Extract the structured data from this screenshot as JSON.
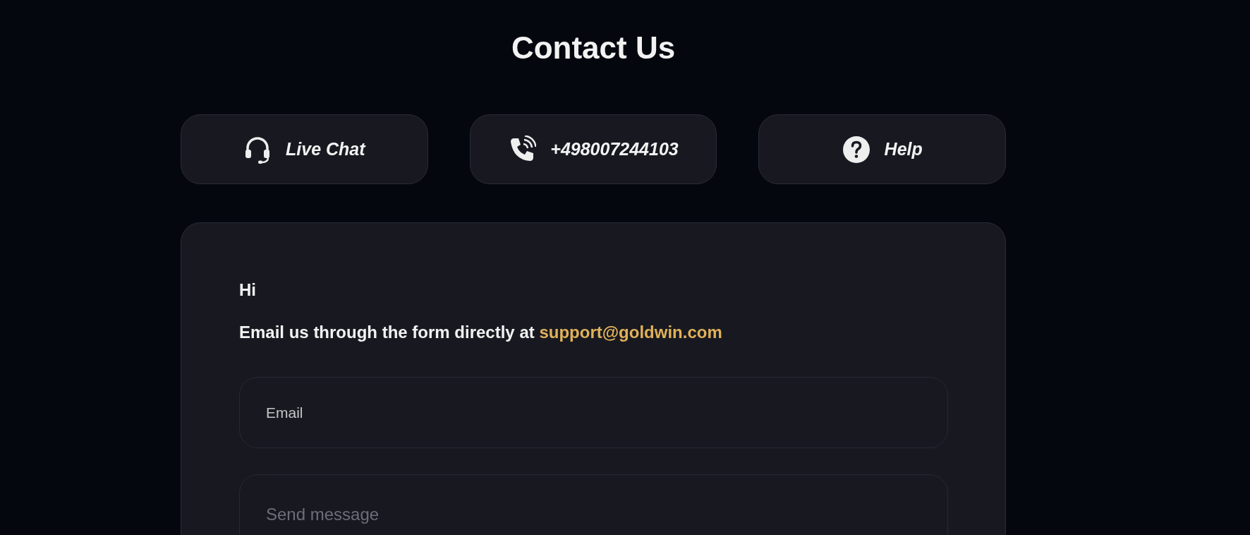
{
  "title": "Contact Us",
  "channels": [
    {
      "kind": "chat",
      "label": "Live Chat"
    },
    {
      "kind": "phone",
      "label": "+498007244103"
    },
    {
      "kind": "help",
      "label": "Help"
    }
  ],
  "form": {
    "greeting": "Hi",
    "intro": "Email us through the form directly at ",
    "email_link": "support@goldwin.com",
    "email_field": {
      "label": "Email"
    },
    "message_field": {
      "placeholder": "Send message"
    }
  }
}
